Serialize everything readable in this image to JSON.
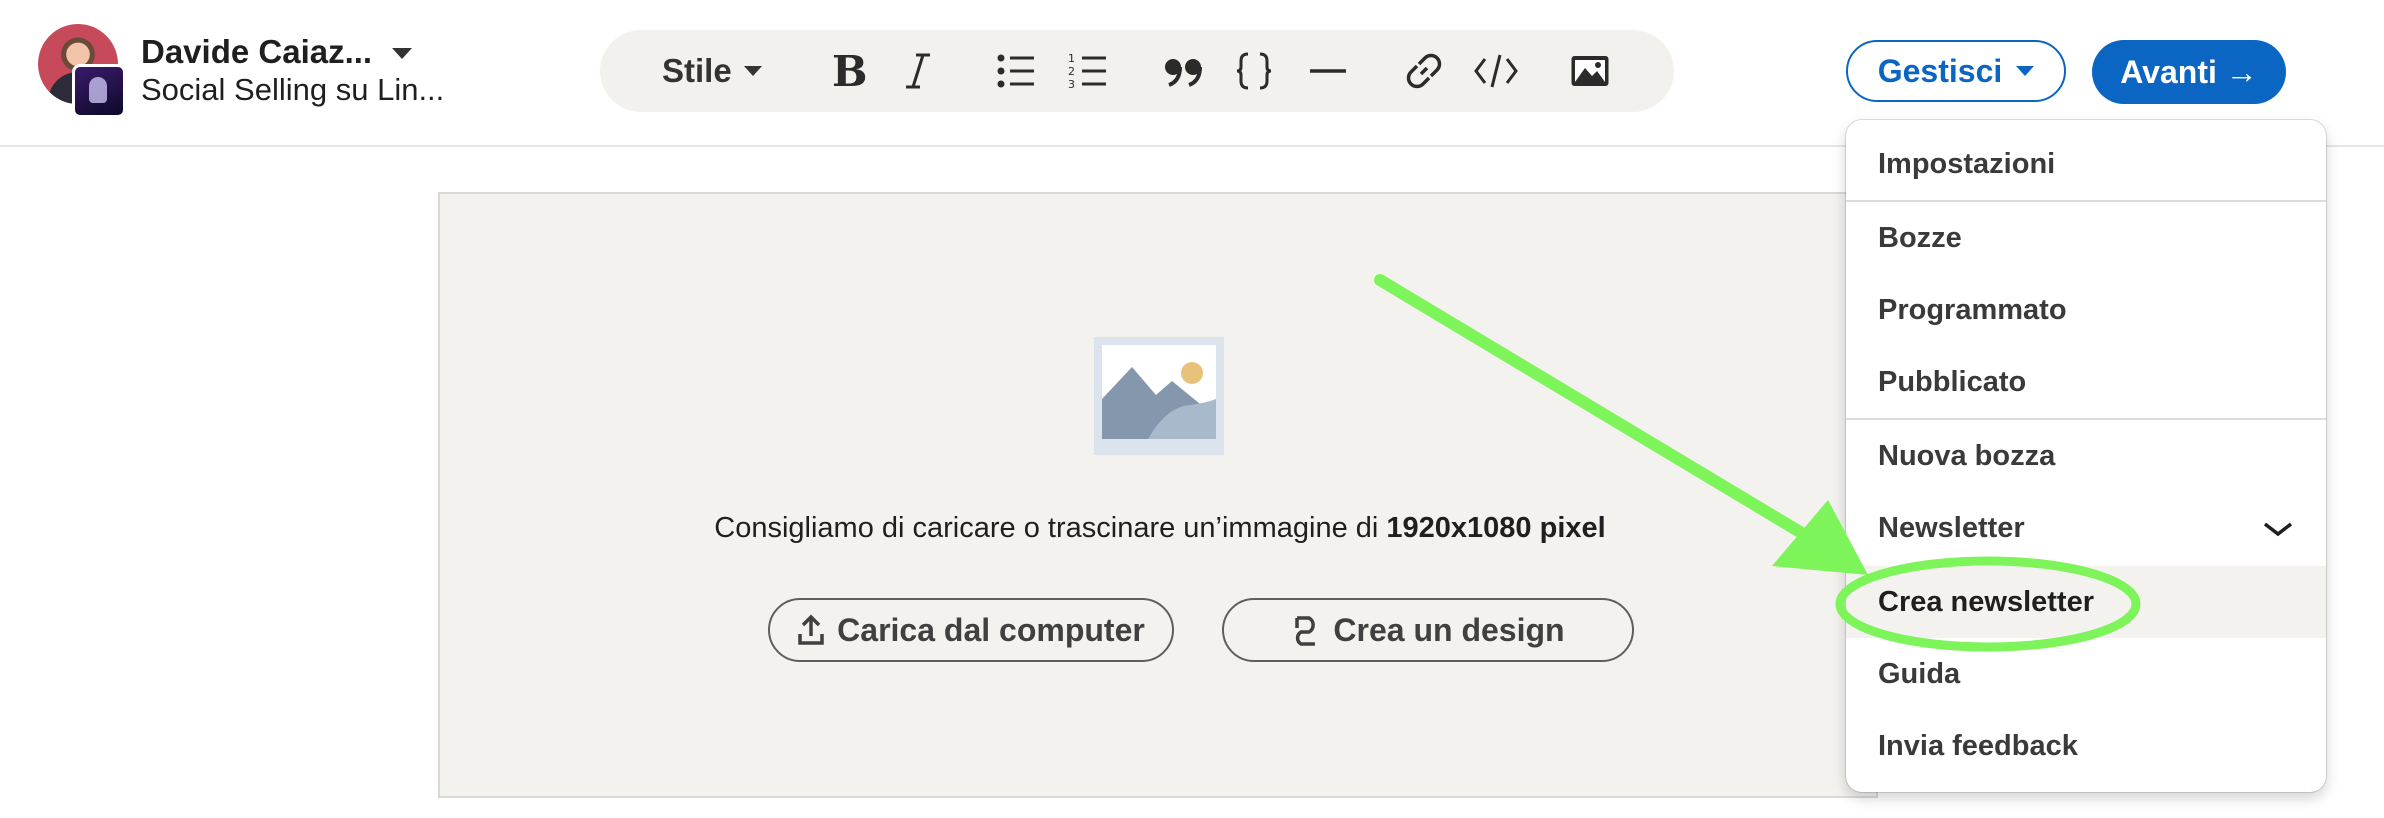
{
  "account": {
    "name": "Davide Caiaz...",
    "subtitle": "Social Selling su Lin..."
  },
  "toolbar": {
    "style_label": "Stile",
    "icons": [
      "bold-icon",
      "italic-icon",
      "bulleted-list-icon",
      "numbered-list-icon",
      "quote-icon",
      "code-block-icon",
      "divider-icon",
      "link-icon",
      "embed-icon",
      "image-icon"
    ]
  },
  "header_buttons": {
    "manage_label": "Gestisci",
    "next_label": "Avanti →"
  },
  "cover": {
    "hint_prefix": "Consigliamo di caricare o trascinare un’immagine di ",
    "hint_size": "1920x1080 pixel",
    "upload_label": "Carica dal computer",
    "design_label": "Crea un design"
  },
  "menu": {
    "items": [
      {
        "label": "Impostazioni"
      },
      {
        "label": "Bozze"
      },
      {
        "label": "Programmato"
      },
      {
        "label": "Pubblicato"
      },
      {
        "label": "Nuova bozza"
      },
      {
        "label": "Newsletter",
        "expanded": true
      },
      {
        "label": "Crea newsletter",
        "highlighted": true
      },
      {
        "label": "Guida"
      },
      {
        "label": "Invia feedback"
      }
    ]
  },
  "colors": {
    "brand_blue": "#0a66c2",
    "annotation_green": "#7cf45a"
  }
}
